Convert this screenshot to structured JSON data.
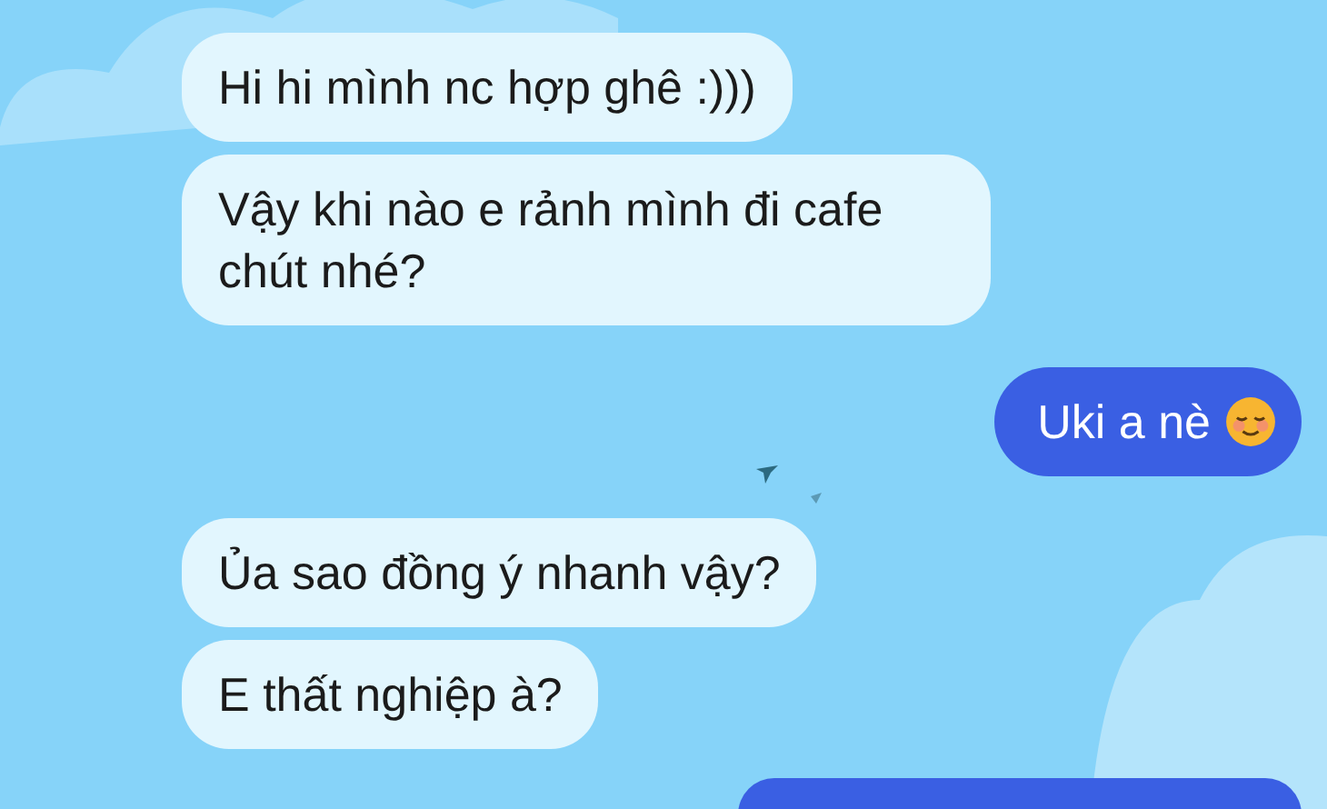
{
  "messages": [
    {
      "kind": "incoming",
      "text": "Hi hi mình nc hợp ghê :)))",
      "emoji": false
    },
    {
      "kind": "incoming",
      "text": "Vậy khi nào e rảnh mình đi cafe chút nhé?",
      "emoji": false
    },
    {
      "kind": "outgoing",
      "text": "Uki a nè",
      "emoji": true
    },
    {
      "kind": "incoming",
      "text": "Ủa sao đồng ý nhanh vậy?",
      "emoji": false
    },
    {
      "kind": "incoming",
      "text": "E thất nghiệp à?",
      "emoji": false
    }
  ]
}
